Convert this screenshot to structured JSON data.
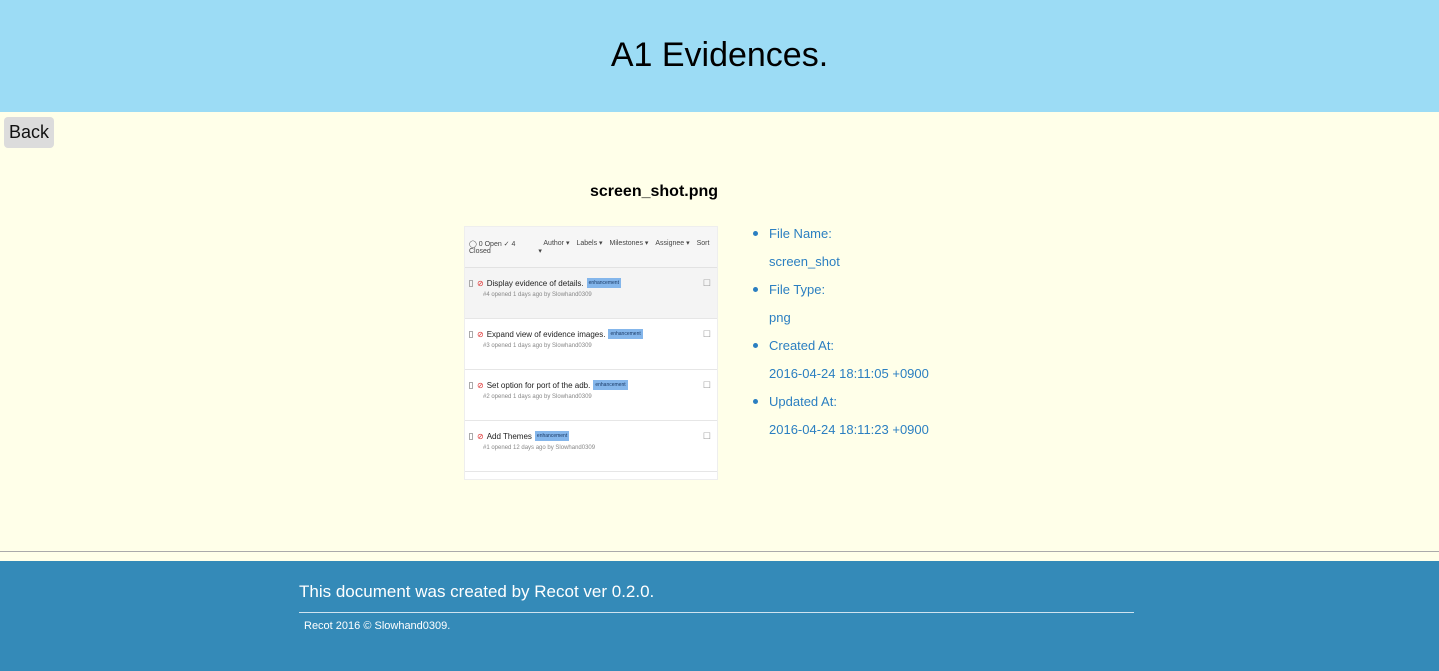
{
  "header": {
    "title": "A1 Evidences."
  },
  "nav": {
    "back_label": "Back"
  },
  "evidence": {
    "file_title": "screen_shot.png",
    "preview": {
      "topbar": {
        "status_text": "◯ 0 Open  ✓ 4 Closed",
        "filters": [
          "Author ▾",
          "Labels ▾",
          "Milestones ▾",
          "Assignee ▾",
          "Sort ▾"
        ]
      },
      "issues": [
        {
          "title": "Display evidence of details.",
          "tag": "enhancement",
          "meta": "#4 opened 1 days ago by Slowhand0309"
        },
        {
          "title": "Expand view of evidence images.",
          "tag": "enhancement",
          "meta": "#3 opened 1 days ago by Slowhand0309"
        },
        {
          "title": "Set option for port of the adb.",
          "tag": "enhancement",
          "meta": "#2 opened 1 days ago by Slowhand0309"
        },
        {
          "title": "Add Themes",
          "tag": "enhancement",
          "meta": "#1 opened 12 days ago by Slowhand0309"
        }
      ]
    },
    "details": [
      {
        "label": "File Name:",
        "value": "screen_shot"
      },
      {
        "label": "File Type:",
        "value": "png"
      },
      {
        "label": "Created At:",
        "value": "2016-04-24 18:11:05 +0900"
      },
      {
        "label": "Updated At:",
        "value": "2016-04-24 18:11:23 +0900"
      }
    ]
  },
  "footer": {
    "created_by": "This document was created by Recot ver 0.2.0.",
    "copyright": "Recot 2016 © Slowhand0309."
  },
  "colors": {
    "header_bg": "#9cdcf5",
    "page_bg": "#ffffe9",
    "footer_bg": "#348ab8",
    "link_blue": "#2b7fc1"
  }
}
